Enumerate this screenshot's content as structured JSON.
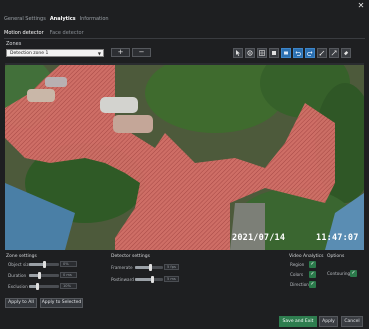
{
  "window": {
    "close_label": "✕"
  },
  "main_tabs": [
    {
      "label": "General Settings",
      "active": false
    },
    {
      "label": "Analytics",
      "active": true
    },
    {
      "label": "Information",
      "active": false
    }
  ],
  "sub_tabs": [
    {
      "label": "Motion detector",
      "active": true
    },
    {
      "label": "Face detector",
      "active": false
    }
  ],
  "zones": {
    "label": "Zones",
    "selected": "Detection zone 1",
    "add_label": "+",
    "remove_label": "−"
  },
  "toolbar_icons": [
    "pointer-icon",
    "select-icon",
    "grid-icon",
    "rectangle-icon",
    "fill-icon",
    "undo-icon",
    "redo-icon",
    "brush-icon",
    "line-icon",
    "eraser-icon"
  ],
  "video": {
    "date": "2021/07/14",
    "time": "11:47:07"
  },
  "zone_settings": {
    "title": "Zone settings",
    "rows": [
      {
        "label": "Object size",
        "value": "0%",
        "level": 0.5
      },
      {
        "label": "Duration",
        "value": "0 ms",
        "level": 0.35
      },
      {
        "label": "Exclusion",
        "value": "10%",
        "level": 0.25
      }
    ]
  },
  "detector_settings": {
    "title": "Detector settings",
    "rows": [
      {
        "label": "Framerate",
        "value": "5 fps",
        "level": 0.55
      },
      {
        "label": "Postinward",
        "value": "5 ms",
        "level": 0.6
      }
    ]
  },
  "video_analytics": {
    "title": "Video Analytics",
    "items": [
      {
        "label": "Region",
        "checked": true
      },
      {
        "label": "Colors",
        "checked": true
      },
      {
        "label": "Direction",
        "checked": true
      }
    ]
  },
  "options": {
    "title": "Options",
    "items": [
      {
        "label": "Contouring",
        "checked": true
      }
    ]
  },
  "buttons": {
    "apply_all": "Apply to All",
    "apply_selected": "Apply to Selected",
    "save_exit": "Save and Exit",
    "apply": "Apply",
    "cancel": "Cancel"
  },
  "colors": {
    "accent_green": "#2e7d4f",
    "zone_overlay": "#e05555",
    "tool_blue": "#2b6fb0"
  }
}
